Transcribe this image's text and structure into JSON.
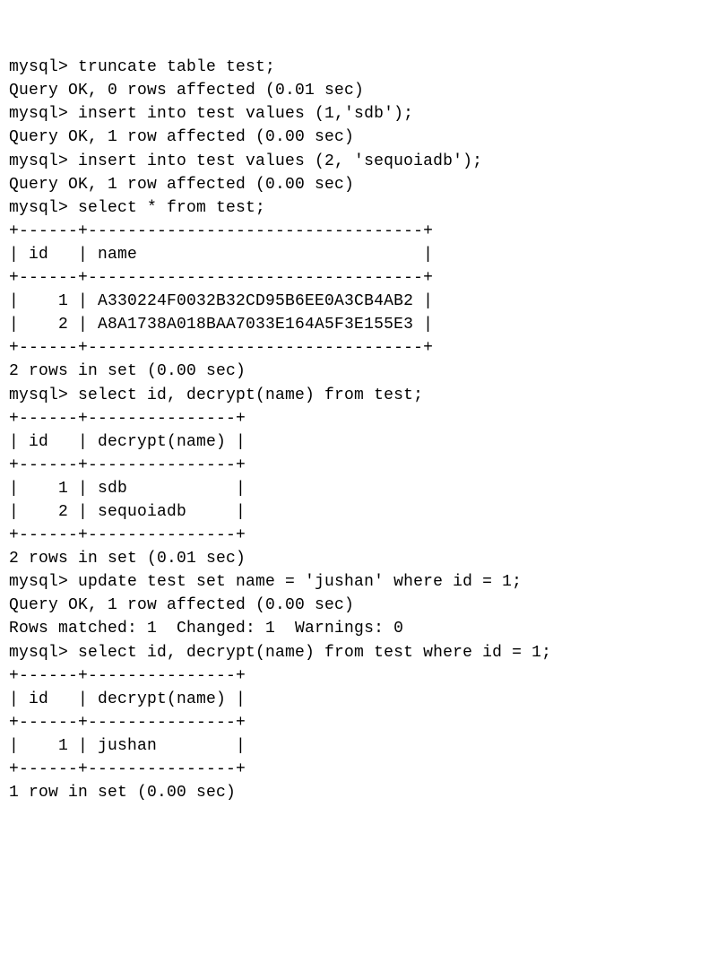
{
  "prompt": "mysql> ",
  "blocks": [
    {
      "cmd": "truncate table test;",
      "resp": [
        "Query OK, 0 rows affected (0.01 sec)"
      ]
    },
    {
      "cmd": "insert into test values (1,'sdb');",
      "resp": [
        "Query OK, 1 row affected (0.00 sec)"
      ]
    },
    {
      "cmd": "insert into test values (2, 'sequoiadb');",
      "resp": [
        "Query OK, 1 row affected (0.00 sec)"
      ]
    },
    {
      "cmd": "select * from test;",
      "resp": [
        "+------+----------------------------------+",
        "| id   | name                             |",
        "+------+----------------------------------+",
        "|    1 | A330224F0032B32CD95B6EE0A3CB4AB2 |",
        "|    2 | A8A1738A018BAA7033E164A5F3E155E3 |",
        "+------+----------------------------------+",
        "2 rows in set (0.00 sec)"
      ]
    },
    {
      "cmd": "select id, decrypt(name) from test;",
      "resp": [
        "+------+---------------+",
        "| id   | decrypt(name) |",
        "+------+---------------+",
        "|    1 | sdb           |",
        "|    2 | sequoiadb     |",
        "+------+---------------+",
        "2 rows in set (0.01 sec)"
      ]
    },
    {
      "cmd": "update test set name = 'jushan' where id = 1;",
      "resp": [
        "Query OK, 1 row affected (0.00 sec)",
        "Rows matched: 1  Changed: 1  Warnings: 0"
      ]
    },
    {
      "cmd": "select id, decrypt(name) from test where id = 1;",
      "resp": [
        "+------+---------------+",
        "| id   | decrypt(name) |",
        "+------+---------------+",
        "|    1 | jushan        |",
        "+------+---------------+",
        "1 row in set (0.00 sec)"
      ]
    }
  ]
}
